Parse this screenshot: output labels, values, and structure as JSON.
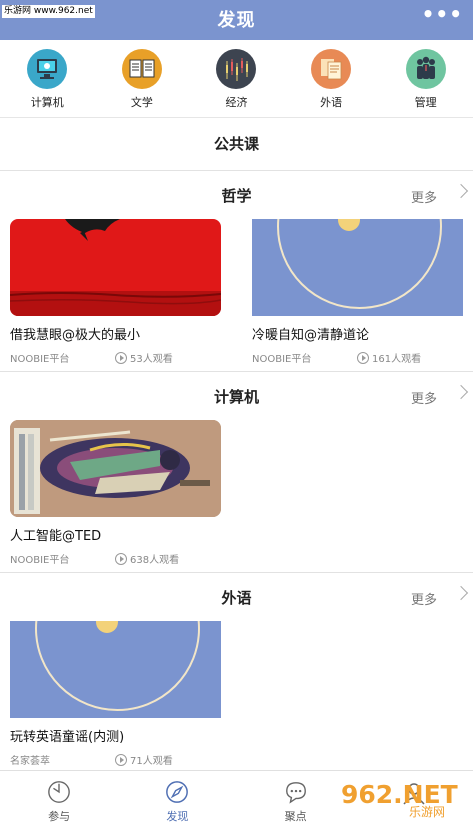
{
  "watermark": "乐游网 www.962.net",
  "header": {
    "title": "发现",
    "more": "•••"
  },
  "categories": [
    {
      "label": "计算机",
      "icon": "computer-icon",
      "color": "#3aa7c9"
    },
    {
      "label": "文学",
      "icon": "book-icon",
      "color": "#e8a028"
    },
    {
      "label": "经济",
      "icon": "chart-icon",
      "color": "#3d4450"
    },
    {
      "label": "外语",
      "icon": "document-icon",
      "color": "#e88a55"
    },
    {
      "label": "管理",
      "icon": "people-icon",
      "color": "#6fc5a0"
    }
  ],
  "public_course": "公共课",
  "sections": [
    {
      "title": "哲学",
      "more": "更多",
      "cards": [
        {
          "title": "借我慧眼@极大的最小",
          "source": "NOOBIE平台",
          "views": "53人观看"
        },
        {
          "title": "冷暖自知@清静道论",
          "source": "NOOBIE平台",
          "views": "161人观看"
        }
      ]
    },
    {
      "title": "计算机",
      "more": "更多",
      "cards": [
        {
          "title": "人工智能@TED",
          "source": "NOOBIE平台",
          "views": "638人观看"
        }
      ]
    },
    {
      "title": "外语",
      "more": "更多",
      "cards": [
        {
          "title": "玩转英语童谣(内测)",
          "source": "名家荟萃",
          "views": "71人观看"
        }
      ]
    }
  ],
  "tabs": [
    {
      "label": "参与",
      "icon": "participate-icon",
      "active": false
    },
    {
      "label": "发现",
      "icon": "compass-icon",
      "active": true
    },
    {
      "label": "聚点",
      "icon": "chat-bubble-icon",
      "active": false
    },
    {
      "label": "",
      "icon": "profile-icon",
      "active": false
    }
  ],
  "brand_watermark": {
    "text": "962.NET",
    "subtext": "乐游网",
    "color": "#f0a030"
  }
}
